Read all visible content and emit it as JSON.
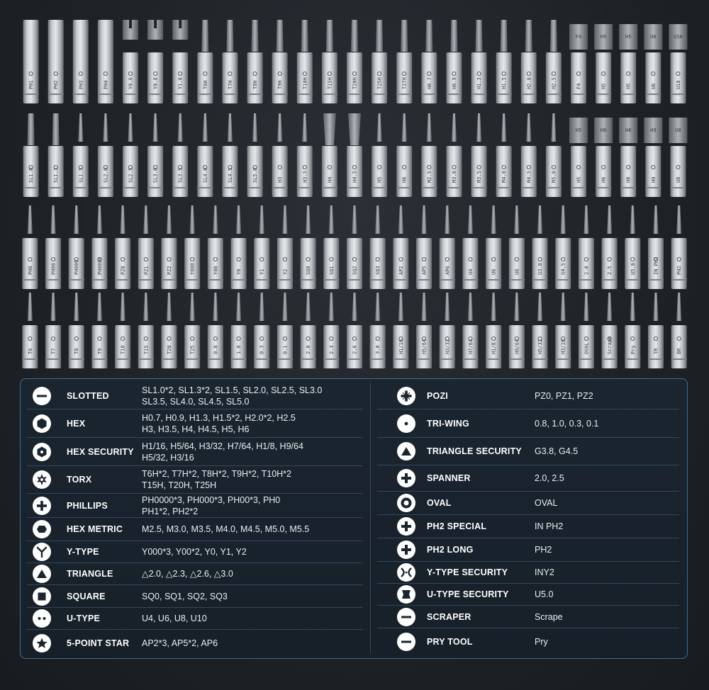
{
  "bits_rows": [
    [
      "PH1",
      "PH2",
      "PH3",
      "PH4",
      "Y0.6",
      "Y0.8",
      "Y1.0",
      "T6H",
      "T7H",
      "T8H",
      "T9H",
      "T10H",
      "T15H",
      "T20H",
      "T25H",
      "T27H",
      "H0.7",
      "H0.9",
      "H1.3",
      "H1.5",
      "H2.0",
      "H2.5",
      "F4",
      "H5",
      "H5",
      "U6",
      "U10"
    ],
    [
      "SL1.0",
      "SL1.3",
      "SL1.5",
      "SL2.0",
      "SL2.5",
      "SL3.0",
      "SL3.5",
      "SL4.0",
      "SL4.5",
      "SL5.0",
      "H3",
      "H3.5",
      "H4",
      "H4.5",
      "H5",
      "H6",
      "M2.5",
      "M3.0",
      "M3.5",
      "M4.0",
      "M4.5",
      "M5.0",
      "H5",
      "H6",
      "H8",
      "H9",
      "U8"
    ],
    [
      "PH0",
      "PH00",
      "PH000",
      "PH0000",
      "PZ0",
      "PZ1",
      "PZ2",
      "Y000",
      "Y00",
      "Y0",
      "Y1",
      "Y2",
      "SQ0",
      "SQ1",
      "SQ2",
      "SQ3",
      "AP2",
      "AP5",
      "AP6",
      "U4",
      "U6",
      "U8",
      "G3.8",
      "G4.5",
      "2.0",
      "2.5",
      "U5.0",
      "IN PH2",
      "PH2"
    ],
    [
      "T6",
      "T7",
      "T8",
      "T9",
      "T10",
      "T15",
      "T20",
      "T25",
      "0.8",
      "1.0",
      "0.3",
      "0.1",
      "2.0",
      "2.3",
      "2.6",
      "3.0",
      "H1/16",
      "H5/64",
      "H3/32",
      "H7/64",
      "H1/8",
      "H9/64",
      "H5/32",
      "H3/16",
      "OVAL",
      "Scrape",
      "Pry",
      "TR",
      "BR"
    ]
  ],
  "left": [
    {
      "icon": "slotted-icon",
      "name": "SLOTTED",
      "values": [
        "SL1.0*2, SL1.3*2, SL1.5, SL2.0, SL2.5, SL3.0",
        "SL3.5, SL4.0, SL4.5, SL5.0"
      ]
    },
    {
      "icon": "hex-icon",
      "name": "HEX",
      "values": [
        "H0.7, H0.9, H1.3, H1.5*2, H2.0*2, H2.5",
        "H3, H3.5, H4, H4.5, H5, H6"
      ]
    },
    {
      "icon": "hex-security-icon",
      "name": "HEX SECURITY",
      "values": [
        "H1/16, H5/64, H3/32, H7/64, H1/8, H9/64",
        "H5/32, H3/16"
      ]
    },
    {
      "icon": "torx-icon",
      "name": "TORX",
      "values": [
        "T6H*2, T7H*2, T8H*2, T9H*2, T10H*2",
        "T15H, T20H, T25H"
      ]
    },
    {
      "icon": "phillips-icon",
      "name": "PHILLIPS",
      "values": [
        "PH0000*3, PH000*3, PH00*3, PH0",
        "PH1*2, PH2*2"
      ]
    },
    {
      "icon": "hex-metric-icon",
      "name": "HEX METRIC",
      "values": [
        "M2.5, M3.0, M3.5, M4.0, M4.5, M5.0, M5.5"
      ]
    },
    {
      "icon": "y-type-icon",
      "name": "Y-TYPE",
      "values": [
        "Y000*3, Y00*2, Y0, Y1, Y2"
      ]
    },
    {
      "icon": "triangle-icon",
      "name": "TRIANGLE",
      "values": [
        "△2.0, △2.3, △2.6, △3.0"
      ]
    },
    {
      "icon": "square-icon",
      "name": "SQUARE",
      "values": [
        "SQ0, SQ1, SQ2, SQ3"
      ]
    },
    {
      "icon": "u-type-icon",
      "name": "U-TYPE",
      "values": [
        "U4, U6, U8, U10"
      ]
    },
    {
      "icon": "star-icon",
      "name": "5-POINT STAR",
      "values": [
        "AP2*3, AP5*2, AP6"
      ]
    }
  ],
  "right": [
    {
      "icon": "pozi-icon",
      "name": "POZI",
      "values": [
        "PZ0, PZ1, PZ2"
      ]
    },
    {
      "icon": "tri-wing-icon",
      "name": "TRI-WING",
      "values": [
        "0.8, 1.0, 0.3, 0.1"
      ]
    },
    {
      "icon": "triangle-security-icon",
      "name": "TRIANGLE SECURITY",
      "values": [
        "G3.8, G4.5"
      ]
    },
    {
      "icon": "spanner-icon",
      "name": "SPANNER",
      "values": [
        "2.0, 2.5"
      ]
    },
    {
      "icon": "oval-icon",
      "name": "OVAL",
      "values": [
        "OVAL"
      ]
    },
    {
      "icon": "ph2-special-icon",
      "name": "PH2 SPECIAL",
      "values": [
        "IN PH2"
      ]
    },
    {
      "icon": "ph2-long-icon",
      "name": "PH2 LONG",
      "values": [
        "PH2"
      ]
    },
    {
      "icon": "y-type-security-icon",
      "name": "Y-TYPE SECURITY",
      "values": [
        "INY2"
      ]
    },
    {
      "icon": "u-type-security-icon",
      "name": "U-TYPE SECURITY",
      "values": [
        "U5.0"
      ]
    },
    {
      "icon": "scraper-icon",
      "name": "SCRAPER",
      "values": [
        "Scrape"
      ]
    },
    {
      "icon": "pry-tool-icon",
      "name": "PRY TOOL",
      "values": [
        "Pry"
      ]
    }
  ],
  "colors": {
    "panel_border": "#3f6d8f",
    "panel_bg": "#1b2530",
    "bit_light": "#d9dcdf",
    "bit_dark": "#7d8287"
  }
}
